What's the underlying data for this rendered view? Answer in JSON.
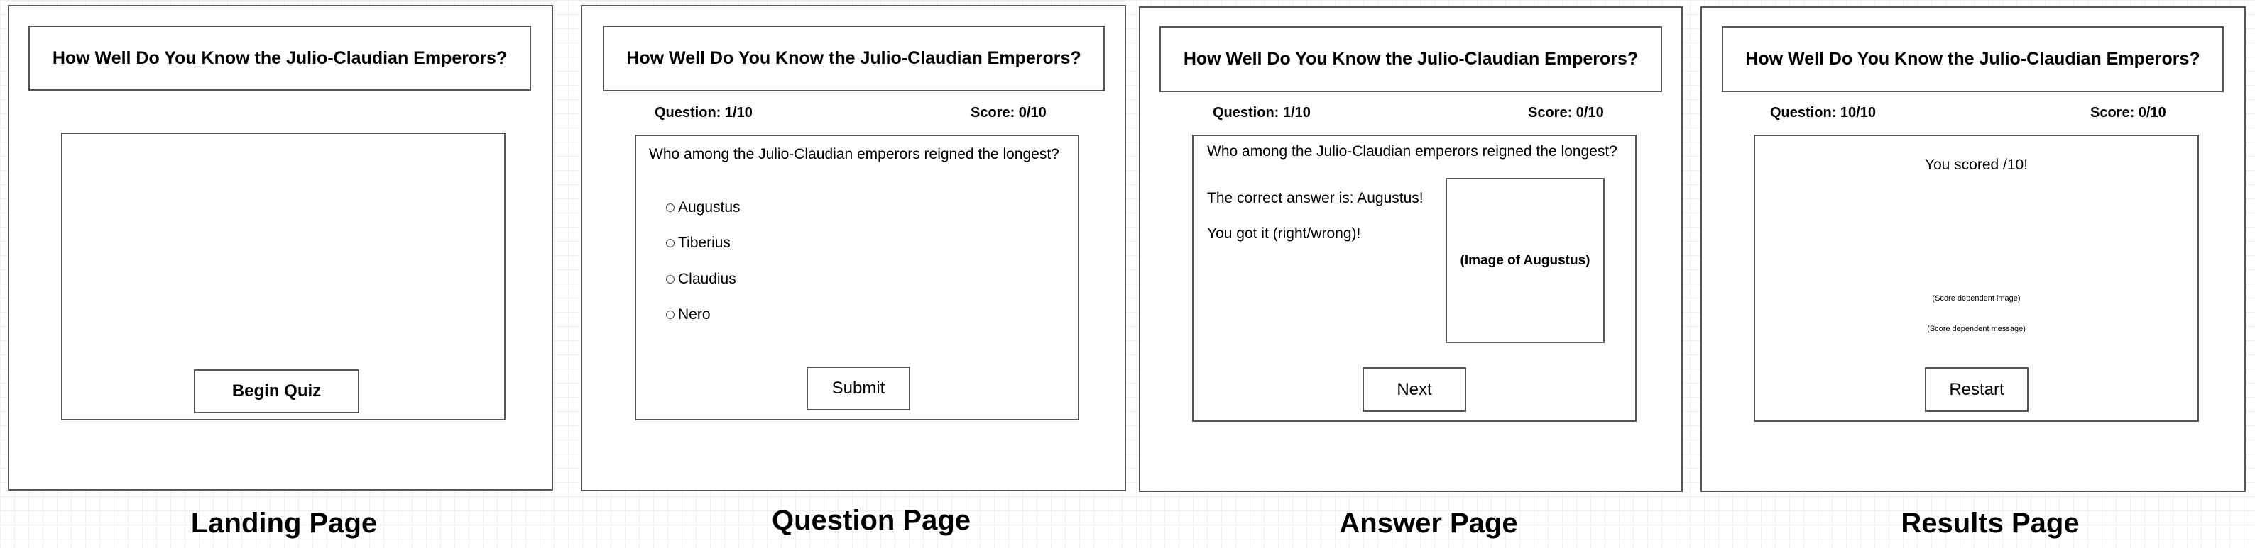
{
  "quiz_title": "How Well Do You Know the Julio-Claudian Emperors?",
  "landing": {
    "caption": "Landing Page",
    "begin_label": "Begin Quiz"
  },
  "question_page": {
    "caption": "Question Page",
    "question_counter": "Question: 1/10",
    "score": "Score: 0/10",
    "question": "Who among the Julio-Claudian emperors reigned the longest?",
    "options": [
      "Augustus",
      "Tiberius",
      "Claudius",
      "Nero"
    ],
    "submit_label": "Submit"
  },
  "answer_page": {
    "caption": "Answer Page",
    "question_counter": "Question: 1/10",
    "score": "Score: 0/10",
    "question": "Who among the Julio-Claudian emperors reigned the longest?",
    "correct_answer": "The correct answer is: Augustus!",
    "result_line": "You got it (right/wrong)!",
    "image_placeholder": "(Image of Augustus)",
    "next_label": "Next"
  },
  "results_page": {
    "caption": "Results Page",
    "question_counter": "Question: 10/10",
    "score": "Score: 0/10",
    "scored_text": "You scored /10!",
    "score_image": "(Score dependent image)",
    "score_message": "(Score dependent message)",
    "restart_label": "Restart"
  }
}
